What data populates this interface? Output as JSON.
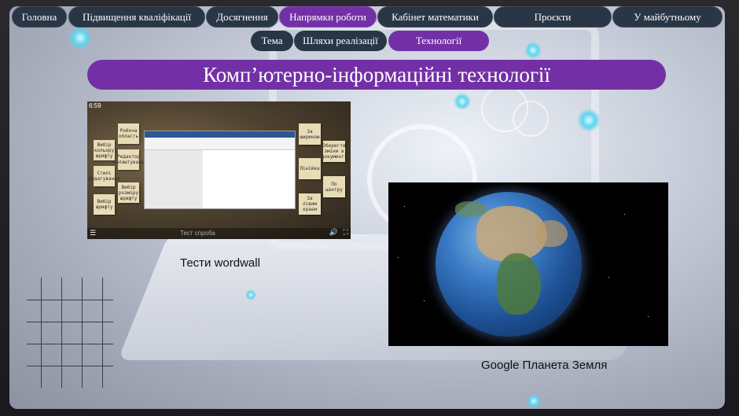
{
  "nav": {
    "tabs": [
      {
        "label": "Головна"
      },
      {
        "label": "Підвищення кваліфікації"
      },
      {
        "label": "Досягнення"
      },
      {
        "label": "Напрямки роботи"
      },
      {
        "label": "Кабінет математики"
      },
      {
        "label": "Проєкти"
      },
      {
        "label": "У майбутньому"
      }
    ],
    "subtabs": [
      {
        "label": "Тема"
      },
      {
        "label": "Шляхи реалізації"
      },
      {
        "label": "Технології"
      }
    ]
  },
  "page": {
    "title": "Комп’ютерно-інформаційні технології"
  },
  "video": {
    "time": "6:59",
    "bottom_label": "Тест спроба",
    "notes": [
      "Робоча область",
      "Вибір кольору шрифту",
      "Редактор налаштувань",
      "Стилі редагування",
      "Вибір розміру шрифту",
      "Вибір шрифту",
      "За шириною",
      "Зберегти зміни в документі",
      "Лінійка",
      "По центру",
      "За лівим краєм"
    ]
  },
  "captions": {
    "wordwall": "Тести wordwall",
    "earth": "Google Планета Земля"
  },
  "colors": {
    "active_tab": "#7330a6",
    "tab": "#283646",
    "accent_glow": "#5fd4ee"
  },
  "icons": [
    "menu-icon",
    "volume-icon",
    "fullscreen-icon"
  ]
}
